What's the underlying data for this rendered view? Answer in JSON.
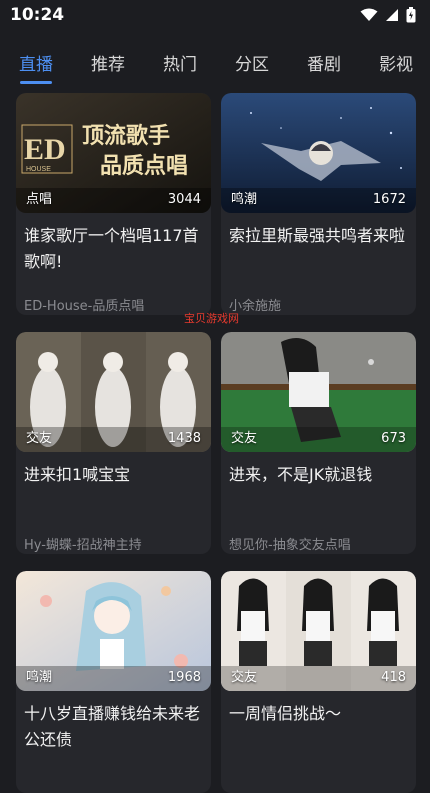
{
  "status": {
    "time": "10:24"
  },
  "tabs": [
    {
      "label": "直播",
      "active": true
    },
    {
      "label": "推荐"
    },
    {
      "label": "热门"
    },
    {
      "label": "分区"
    },
    {
      "label": "番剧"
    },
    {
      "label": "影视"
    }
  ],
  "cards": [
    {
      "tag": "点唱",
      "count": "3044",
      "title": "谁家歌厅一个档唱117首歌啊!",
      "host": "ED-House-品质点唱",
      "thumb_text": {
        "brand": "ED",
        "brand_sub": "HOUSE",
        "line1": "顶流歌手",
        "line2": "品质点唱"
      }
    },
    {
      "tag": "鸣潮",
      "count": "1672",
      "title": "索拉里斯最强共鸣者来啦",
      "host": "小余施施"
    },
    {
      "tag": "交友",
      "count": "1438",
      "title": "进来扣1喊宝宝",
      "host": "Hy-蝴蝶-招战神主持"
    },
    {
      "tag": "交友",
      "count": "673",
      "title": "进来，不是JK就退钱",
      "host": "想见你-抽象交友点唱"
    },
    {
      "tag": "鸣潮",
      "count": "1968",
      "title": "十八岁直播赚钱给未来老公还债",
      "host": ""
    },
    {
      "tag": "交友",
      "count": "418",
      "title": "一周情侣挑战～",
      "host": ""
    }
  ],
  "watermark": "宝贝游戏网",
  "colors": {
    "accent": "#4d8ff1",
    "background": "#1c1d21",
    "card": "#26272c",
    "watermark": "#e63a2e"
  }
}
